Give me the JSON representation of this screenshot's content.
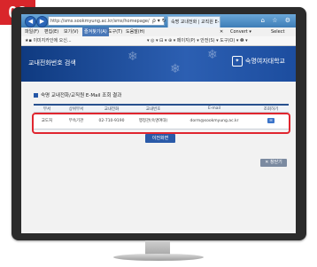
{
  "step_badge": "03",
  "browser": {
    "url": "http://sms.sookmyung.ac.kr/sms/homepage/",
    "url_icons": "ρ ▾ ↻",
    "tab_title": "숙명 교내전화 | 교직원 E-...",
    "window_controls": "⌂ ☆ ⚙",
    "menu": [
      {
        "label": "파일(F)"
      },
      {
        "label": "편집(E)"
      },
      {
        "label": "보기(V)"
      },
      {
        "label": "즐겨찾기(A)"
      },
      {
        "label": "도구(T)"
      },
      {
        "label": "도움말(H)"
      }
    ],
    "menu_close": "✕",
    "convert_label": "Convert ▾",
    "select_label": "Select",
    "cmd_left": "★▪ 이미지카인에 오신...",
    "cmd_right": "▾ ◎ ▾ ⊟ ▾ ⊕ ▾ 페이지(P) ▾ 안전(S) ▾ 도구(O) ▾ ❷ ▾"
  },
  "page": {
    "title": "교내전화번호 검색",
    "logo_text": "숙명여자대학교",
    "section_title": "숙명 교내전화/교직원 E-Mail 조회 결과",
    "table": {
      "headers": [
        "부서",
        "상위부서",
        "교내전화",
        "교내번호",
        "E-mail",
        "조회하기"
      ],
      "rows": [
        {
          "dept": "교도처",
          "parent": "부속기관",
          "phone": "02-710-9190",
          "ext": "행정관(숙명여대)",
          "email": "dorm@sookmyung.ac.kr",
          "action": "✉"
        }
      ]
    },
    "prev_button": "이전화면",
    "close_button": "✕ 창닫기"
  }
}
